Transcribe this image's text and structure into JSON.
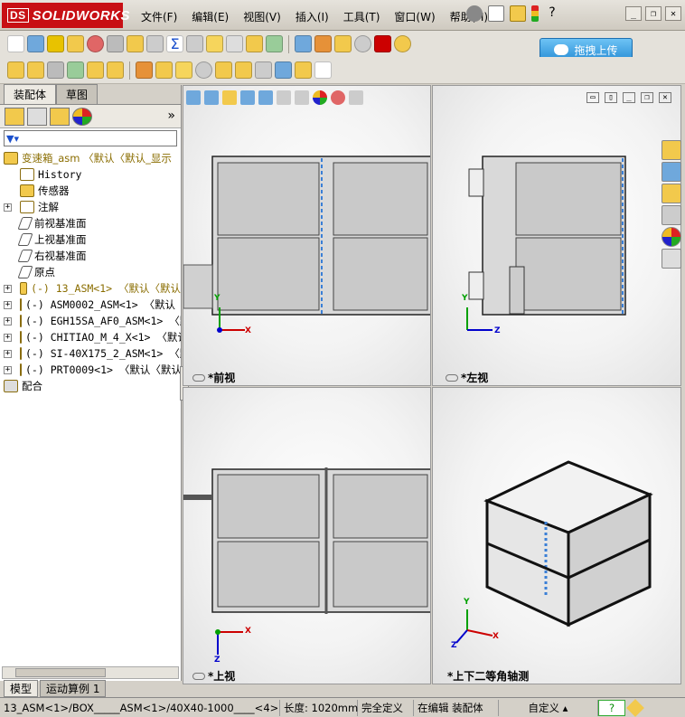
{
  "app": {
    "brand": "SOLIDWORKS",
    "brand_prefix": "DS"
  },
  "menu": [
    "文件(F)",
    "编辑(E)",
    "视图(V)",
    "插入(I)",
    "工具(T)",
    "窗口(W)",
    "帮助(H)"
  ],
  "upload_button": "拖拽上传",
  "left_tabs": [
    "装配体",
    "草图"
  ],
  "tree": [
    {
      "label": "变速箱_asm  〈默认〈默认_显示",
      "exp": "",
      "icon": "assembly-warning-icon",
      "indent": 0,
      "mono": false
    },
    {
      "label": "History",
      "exp": "",
      "icon": "history-icon",
      "indent": 1,
      "mono": true
    },
    {
      "label": "传感器",
      "exp": "",
      "icon": "sensor-icon",
      "indent": 1,
      "mono": false
    },
    {
      "label": "注解",
      "exp": "+",
      "icon": "annotation-icon",
      "indent": 1,
      "mono": false
    },
    {
      "label": "前视基准面",
      "exp": "",
      "icon": "plane-icon",
      "indent": 1,
      "mono": false
    },
    {
      "label": "上视基准面",
      "exp": "",
      "icon": "plane-icon",
      "indent": 1,
      "mono": false
    },
    {
      "label": "右视基准面",
      "exp": "",
      "icon": "plane-icon",
      "indent": 1,
      "mono": false
    },
    {
      "label": "原点",
      "exp": "",
      "icon": "origin-icon",
      "indent": 1,
      "mono": false
    },
    {
      "label": "(-) 13_ASM<1> 〈默认〈默认",
      "exp": "+",
      "icon": "subassembly-warning-icon",
      "indent": 1,
      "mono": true
    },
    {
      "label": "(-) ASM0002_ASM<1> 〈默认〈",
      "exp": "+",
      "icon": "subassembly-icon",
      "indent": 1,
      "mono": true
    },
    {
      "label": "(-) EGH15SA_AF0_ASM<1> 〈默",
      "exp": "+",
      "icon": "subassembly-icon",
      "indent": 1,
      "mono": true
    },
    {
      "label": "(-) CHITIAO_M_4_X<1> 〈默认",
      "exp": "+",
      "icon": "subassembly-icon",
      "indent": 1,
      "mono": true
    },
    {
      "label": "(-) SI-40X175_2_ASM<1> 〈默",
      "exp": "+",
      "icon": "subassembly-icon",
      "indent": 1,
      "mono": true
    },
    {
      "label": "(-) PRT0009<1> 〈默认〈默认",
      "exp": "+",
      "icon": "part-icon",
      "indent": 1,
      "mono": true
    },
    {
      "label": "配合",
      "exp": "",
      "icon": "mates-icon",
      "indent": 0,
      "mono": false
    }
  ],
  "bottom_tabs": [
    "模型",
    "运动算例 1"
  ],
  "viewports": {
    "front": "*前视",
    "left": "*左视",
    "top": "*上视",
    "iso": "*上下二等角轴测"
  },
  "axes": {
    "x": "X",
    "y": "Y",
    "z": "Z"
  },
  "status": {
    "path": "13_ASM<1>/BOX_____ASM<1>/40X40-1000____<4>",
    "length": "长度: 1020mm",
    "defined": "完全定义",
    "editing": "在编辑 装配体",
    "custom": "自定义",
    "help": "?"
  },
  "colors": {
    "brand_red": "#c80f14",
    "warning": "#e8c200",
    "axis_x": "#cc0000",
    "axis_y": "#00a000",
    "axis_z": "#0000cc"
  }
}
